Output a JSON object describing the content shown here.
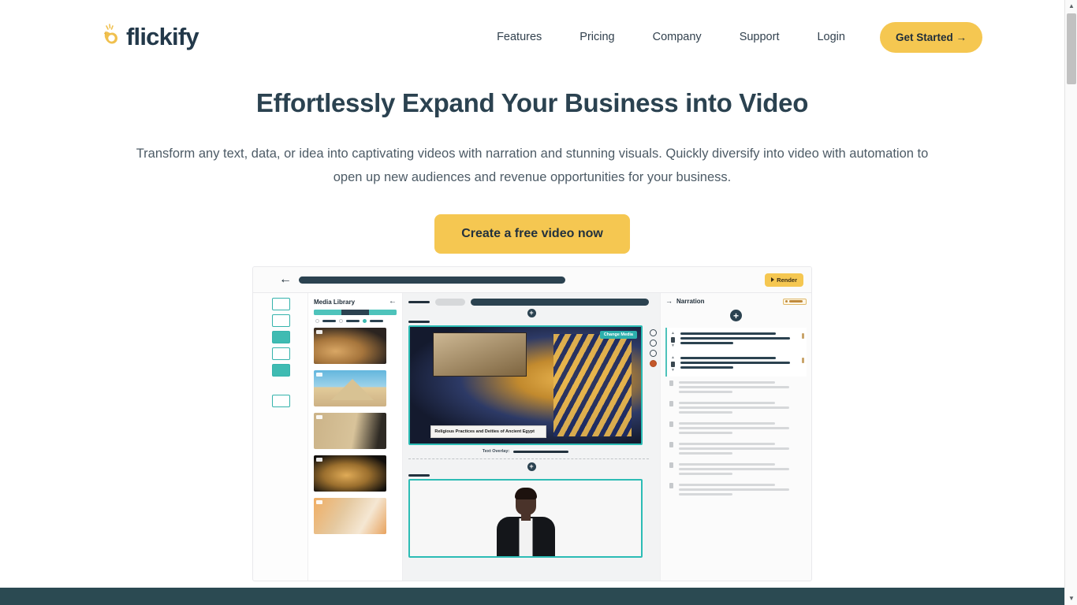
{
  "brand": {
    "name": "flickify",
    "logo_icon": "hand-snap-icon",
    "accent_yellow": "#f5c751",
    "dark_navy": "#2b4250",
    "teal": "#3fbbb2"
  },
  "nav": {
    "items": [
      {
        "label": "Features"
      },
      {
        "label": "Pricing"
      },
      {
        "label": "Company"
      },
      {
        "label": "Support"
      },
      {
        "label": "Login"
      }
    ],
    "cta": {
      "label": "Get Started →"
    }
  },
  "hero": {
    "title": "Effortlessly Expand Your Business into Video",
    "subtitle": "Transform any text, data, or idea into captivating videos with narration and stunning visuals.  Quickly diversify into video with automation to open up new audiences and revenue opportunities for your business.",
    "cta": {
      "label": "Create a free video now"
    }
  },
  "app_preview": {
    "topbar": {
      "back_icon": "back-arrow-icon",
      "render_button": {
        "label": "Render",
        "icon": "play-icon"
      }
    },
    "media_library": {
      "title": "Media Library",
      "collapse_icon": "chevron-left-icon",
      "thumbnails": [
        {
          "name": "sarcophagus-thumbnail"
        },
        {
          "name": "pyramid-thumbnail"
        },
        {
          "name": "hieroglyphics-thumbnail"
        },
        {
          "name": "mummy-thumbnail"
        },
        {
          "name": "pharaoh-statue-thumbnail"
        }
      ]
    },
    "canvas": {
      "change_media_label": "Change Media",
      "caption": "Religious Practices and Deities of Ancient Egypt",
      "text_overlay_label": "Text Overlay:",
      "add_icon": "plus-circle-icon",
      "scene2_name": "presenter-avatar"
    },
    "narration": {
      "title": "Narration",
      "expand_icon": "arrow-right-icon",
      "add_icon": "plus-circle-icon",
      "active_items": 2,
      "dim_items": 6
    }
  },
  "scrollbar": {
    "up_icon": "▲",
    "down_icon": "▼"
  }
}
